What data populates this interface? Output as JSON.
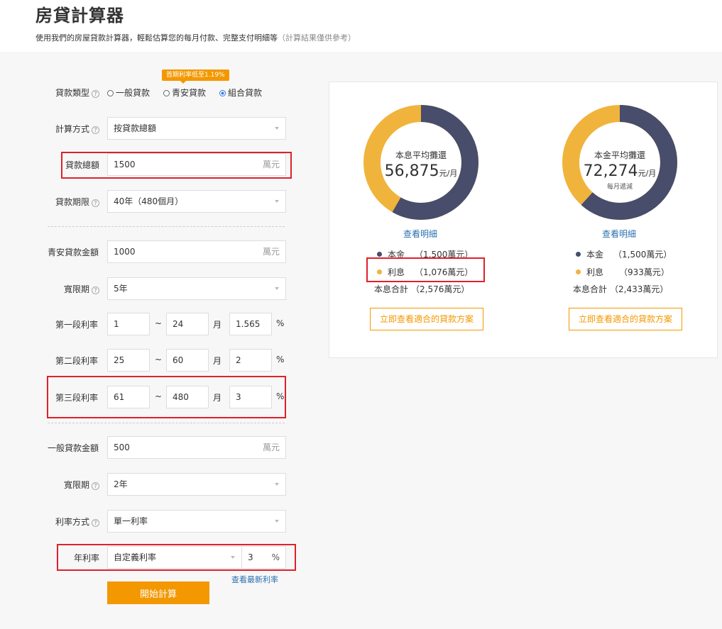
{
  "header": {
    "title": "房貸計算器",
    "subtitle": "使用我們的房屋貸款計算器，輕鬆估算您的每月付款、完整支付明細等",
    "subtitle_note": "（計算結果僅供參考）"
  },
  "form": {
    "loan_type": {
      "label": "貸款類型",
      "options": [
        "一般貸款",
        "青安貸款",
        "組合貸款"
      ],
      "selected": "組合貸款",
      "tip": "首期利率低至1.19%"
    },
    "calc_method": {
      "label": "計算方式",
      "value": "按貸款總額"
    },
    "loan_total": {
      "label": "貸款總額",
      "value": "1500",
      "unit": "萬元"
    },
    "loan_term": {
      "label": "貸款期限",
      "value": "40年（480個月）"
    },
    "qa_amount": {
      "label": "青安貸款金額",
      "value": "1000",
      "unit": "萬元"
    },
    "qa_grace": {
      "label": "寬限期",
      "value": "5年"
    },
    "stage1": {
      "label": "第一段利率",
      "from": "1",
      "tilde": "~",
      "to": "24",
      "month": "月",
      "rate": "1.565",
      "pct": "%"
    },
    "stage2": {
      "label": "第二段利率",
      "from": "25",
      "tilde": "~",
      "to": "60",
      "month": "月",
      "rate": "2",
      "pct": "%"
    },
    "stage3": {
      "label": "第三段利率",
      "from": "61",
      "tilde": "~",
      "to": "480",
      "month": "月",
      "rate": "3",
      "pct": "%"
    },
    "gen_amount": {
      "label": "一般貸款金額",
      "value": "500",
      "unit": "萬元"
    },
    "gen_grace": {
      "label": "寬限期",
      "value": "2年"
    },
    "rate_method": {
      "label": "利率方式",
      "value": "單一利率"
    },
    "annual_rate": {
      "label": "年利率",
      "select": "自定義利率",
      "value": "3",
      "pct": "%"
    },
    "latest_rate_link": "查看最新利率",
    "calc_button": "開始計算"
  },
  "results": [
    {
      "center_title": "本息平均攤還",
      "amount": "56,875",
      "unit": "元/月",
      "sub": "",
      "detail_link": "查看明細",
      "principal_label": "本金",
      "principal": "（1,500萬元）",
      "interest_label": "利息",
      "interest": "（1,076萬元）",
      "total_label": "本息合計",
      "total": "（2,576萬元）",
      "button": "立即查看適合的貸款方案",
      "principal_share": 0.583
    },
    {
      "center_title": "本金平均攤還",
      "amount": "72,274",
      "unit": "元/月",
      "sub": "每月遞減",
      "detail_link": "查看明細",
      "principal_label": "本金",
      "principal": "（1,500萬元）",
      "interest_label": "利息",
      "interest": "（933萬元）",
      "total_label": "本息合計",
      "total": "（2,433萬元）",
      "button": "立即查看適合的貸款方案",
      "principal_share": 0.617
    }
  ],
  "colors": {
    "principal": "#474d6b",
    "interest": "#f0b43c",
    "accent": "#f39800",
    "highlight": "#e0202a",
    "link": "#2a6fb0"
  },
  "icons": {
    "help": "question-circle-icon",
    "dropdown": "caret-down-icon"
  }
}
